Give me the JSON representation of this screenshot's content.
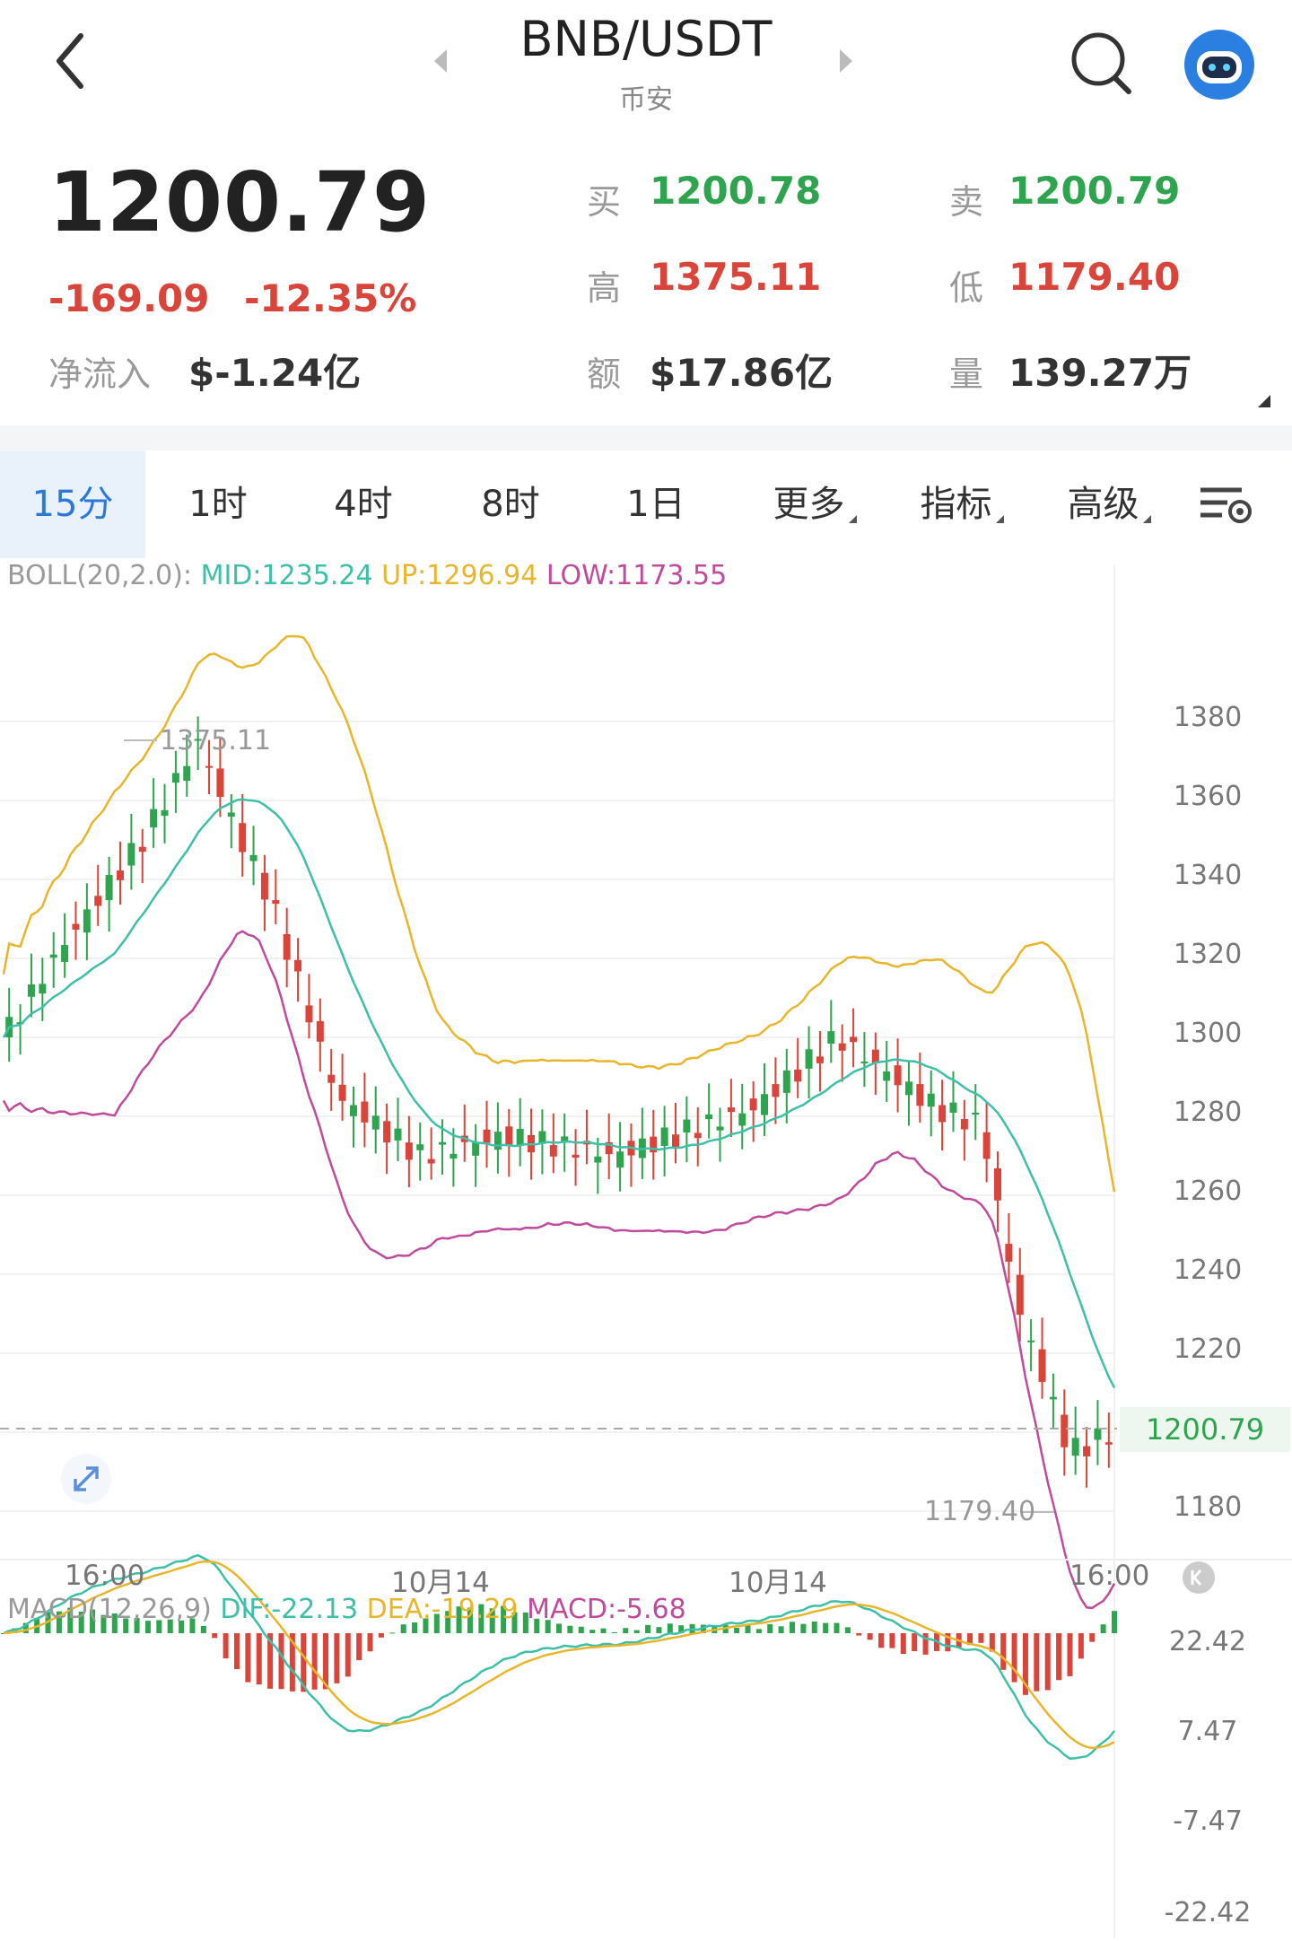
{
  "header": {
    "title": "BNB/USDT",
    "exchange": "币安"
  },
  "ticker": {
    "last_price": "1200.79",
    "change": "-169.09",
    "change_pct": "-12.35%",
    "net_inflow_label": "净流入",
    "net_inflow": "$-1.24亿",
    "bid_label": "买",
    "bid": "1200.78",
    "ask_label": "卖",
    "ask": "1200.79",
    "high_label": "高",
    "high": "1375.11",
    "low_label": "低",
    "low": "1179.40",
    "amount_label": "额",
    "amount": "$17.86亿",
    "volume_label": "量",
    "volume": "139.27万"
  },
  "tabs": [
    {
      "label": "15分",
      "active": true
    },
    {
      "label": "1时"
    },
    {
      "label": "4时"
    },
    {
      "label": "8时"
    },
    {
      "label": "1日"
    },
    {
      "label": "更多"
    },
    {
      "label": "指标"
    },
    {
      "label": "高级"
    }
  ],
  "boll": {
    "name": "BOLL(20,2.0):",
    "mid": "MID:1235.24",
    "up": "UP:1296.94",
    "low": "LOW:1173.55"
  },
  "macd": {
    "name": "MACD(12,26,9)",
    "dif": "DIF:-22.13",
    "dea": "DEA:-19.29",
    "macd": "MACD:-5.68"
  },
  "price_axis": [
    "1380",
    "1360",
    "1340",
    "1320",
    "1300",
    "1280",
    "1260",
    "1240",
    "1220",
    "1180"
  ],
  "macd_axis": [
    "22.42",
    "7.47",
    "-7.47",
    "-22.42"
  ],
  "time_axis": [
    "16:00",
    "10月14",
    "10月14",
    "16:00"
  ],
  "current_price_tag": "1200.79",
  "high_marker": "1375.11",
  "low_marker": "1179.40",
  "colors": {
    "up": "#2ea44f",
    "down": "#d9453a",
    "mid": "#3dbfa8",
    "upper": "#e8b62a",
    "lower": "#c04a9c",
    "accent": "#2a79d8"
  }
}
